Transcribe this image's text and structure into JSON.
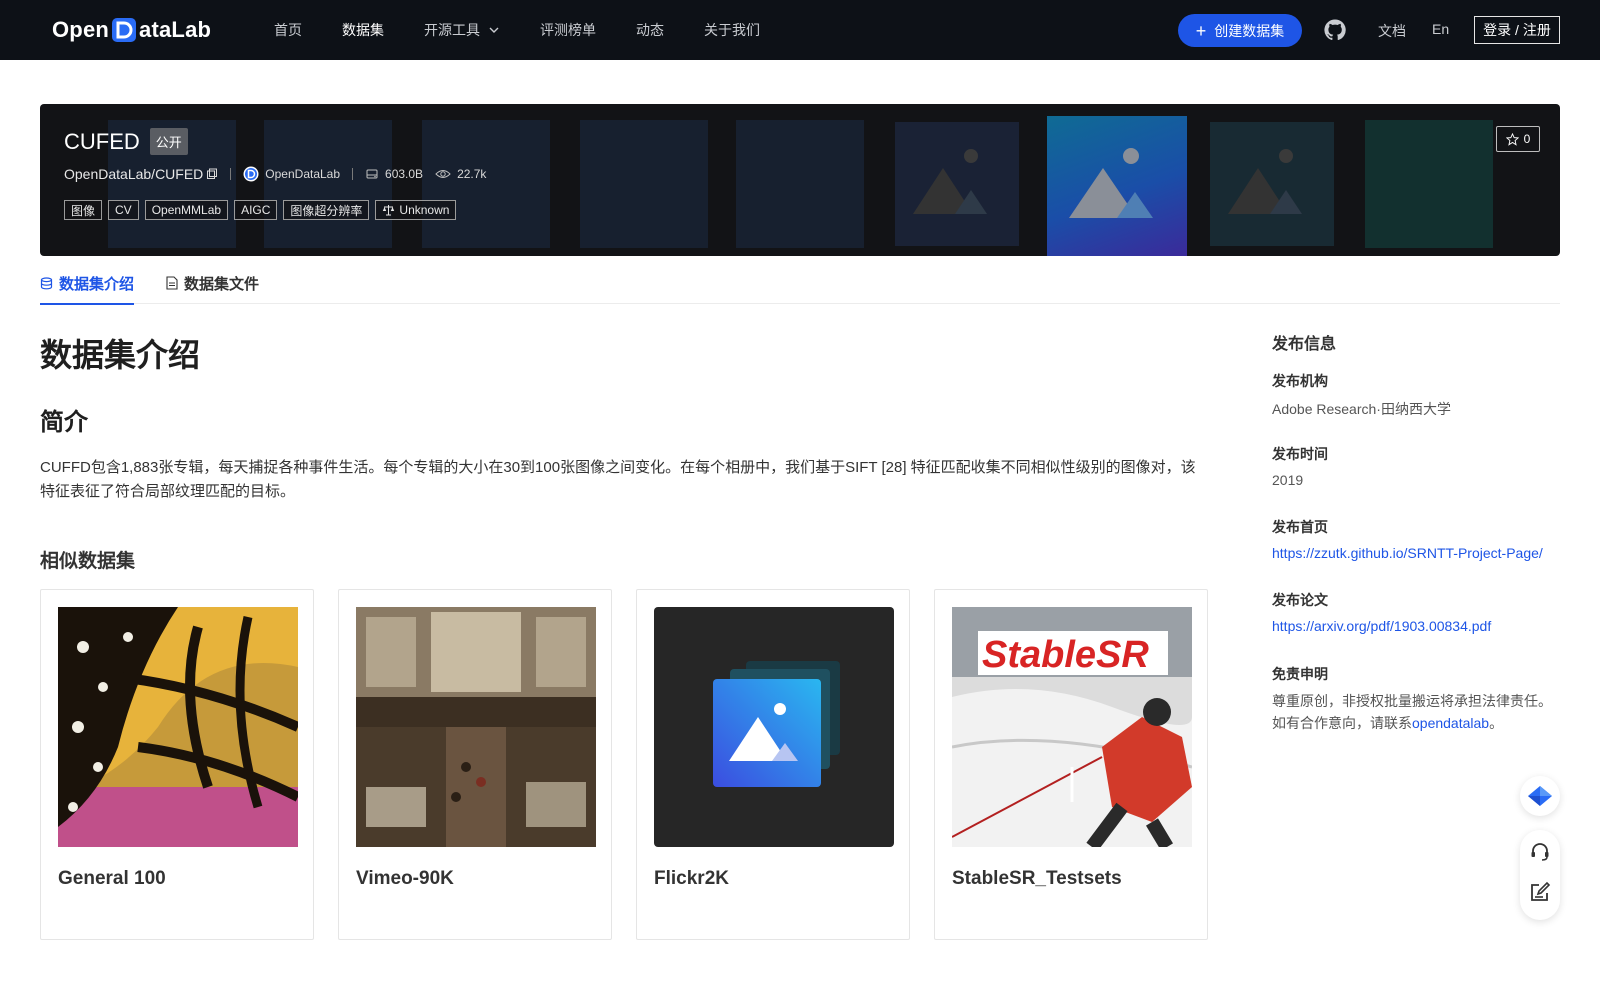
{
  "nav": {
    "logo_left": "Open",
    "logo_right": "ataLab",
    "links": [
      "首页",
      "数据集",
      "开源工具",
      "评测榜单",
      "动态",
      "关于我们"
    ],
    "create_label": "创建数据集",
    "doc_label": "文档",
    "lang_label": "En",
    "login_label": "登录 / 注册"
  },
  "dataset": {
    "name": "CUFED",
    "visibility": "公开",
    "repo": "OpenDataLab/CUFED",
    "org": "OpenDataLab",
    "size": "603.0B",
    "views": "22.7k",
    "tags": [
      "图像",
      "CV",
      "OpenMMLab",
      "AIGC",
      "图像超分辨率"
    ],
    "license": "Unknown",
    "stars": "0"
  },
  "tabs": [
    "数据集介绍",
    "数据集文件"
  ],
  "main": {
    "title": "数据集介绍",
    "intro_title": "简介",
    "intro_text": "CUFFD包含1,883张专辑，每天捕捉各种事件生活。每个专辑的大小在30到100张图像之间变化。在每个相册中，我们基于SIFT [28] 特征匹配收集不同相似性级别的图像对，该特征表征了符合局部纹理匹配的目标。",
    "similar_title": "相似数据集",
    "similar": [
      {
        "name": "General 100",
        "thumb": "butterfly"
      },
      {
        "name": "Vimeo-90K",
        "thumb": "market"
      },
      {
        "name": "Flickr2K",
        "thumb": "placeholder"
      },
      {
        "name": "StableSR_Testsets",
        "thumb": "stablesr",
        "thumb_text": "StableSR"
      }
    ]
  },
  "sidebar": {
    "title": "发布信息",
    "org_label": "发布机构",
    "org_value": "Adobe Research·田纳西大学",
    "time_label": "发布时间",
    "time_value": "2019",
    "home_label": "发布首页",
    "home_value": "https://zzutk.github.io/SRNTT-Project-Page/",
    "paper_label": "发布论文",
    "paper_value": "https://arxiv.org/pdf/1903.00834.pdf",
    "disclaimer_label": "免责申明",
    "disclaimer_line1": "尊重原创，非授权批量搬运将承担法律责任。",
    "disclaimer_line2_prefix": "如有合作意向，请联系",
    "disclaimer_link": "opendatalab",
    "disclaimer_suffix": "。"
  },
  "colors": {
    "nav_bg": "#0d1117",
    "brand_blue": "#1e55e6",
    "banner_bg": "#121316"
  },
  "icons": [
    "logo-d-icon",
    "chevron-down-icon",
    "plus-icon",
    "github-icon",
    "copy-icon",
    "org-avatar-icon",
    "disk-icon",
    "eye-icon",
    "scale-icon",
    "star-icon",
    "database-icon",
    "file-icon",
    "ai-assistant-icon",
    "headset-icon",
    "feedback-icon"
  ]
}
